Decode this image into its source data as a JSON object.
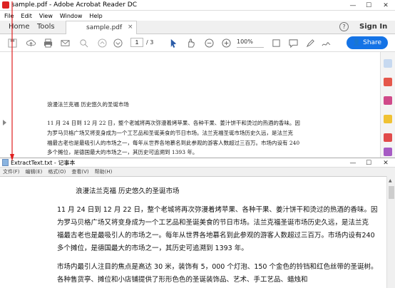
{
  "acrobat": {
    "title": "sample.pdf - Adobe Acrobat Reader DC",
    "menu": [
      "File",
      "Edit",
      "View",
      "Window",
      "Help"
    ],
    "tabs": {
      "home": "Home",
      "tools": "Tools",
      "document": "sample.pdf",
      "close": "×"
    },
    "help": "?",
    "sign_in": "Sign In",
    "page": {
      "current": "1",
      "total": "/ 3"
    },
    "zoom": "100%",
    "share": "Share",
    "doc_lines": [
      "浪漫法兰克福 历史悠久的圣诞市场",
      "11 月 24 日到 12 月 22 日，整个老城将再次弥漫着烤苹果、各种干果、姜汁饼干和烫过的热酒的香味。因",
      "为罗马贝格广场又将变身成为一个工艺品和圣诞美食的节日市场。法兰克福圣诞市场历史久远，是法兰克",
      "福最古老也是最吸引人的市场之一，每年从世界各地慕名到此参观的游客人数超过三百万。市场内设有 240",
      "多个摊位，是德国最大的市场之一，其历史可追溯到 1393 年。"
    ]
  },
  "notepad": {
    "title": "ExtractText.txt - 记事本",
    "menu": [
      "文件(F)",
      "编辑(E)",
      "格式(O)",
      "查看(V)",
      "帮助(H)"
    ],
    "lines": [
      "浪漫法兰克福 历史悠久的圣诞市场",
      "11 月 24 日到 12 月 22 日，整个老城将再次弥漫着烤苹果、各种干果、姜汁饼干和烫过的热酒的香味。因",
      "为罗马贝格广场又将变身成为一个工艺品和圣诞美食的节日市场。法兰克福圣诞市场历史久远，是法兰克",
      "福最古老也是最吸引人的市场之一。每年从世界各地慕名到此参观的游客人数超过三百万。市场内设有240",
      "多个摊位，是德国最大的市场之一，其历史可追溯到 1393 年。",
      "市场内最引人注目的焦点是高达 30 米，装饰有 5，000 个灯泡、150 个金色的铃铛和红色丝带的圣诞树。",
      "各种售货亭、摊位和小店铺提供了形形色色的圣诞装饰品、艺术、手工艺品、蜡烛和"
    ]
  },
  "colors": {
    "accent": "#1473e6",
    "arrow": "#e02020"
  },
  "window_buttons": {
    "minimize": "—",
    "maximize": "☐",
    "close": "✕"
  }
}
